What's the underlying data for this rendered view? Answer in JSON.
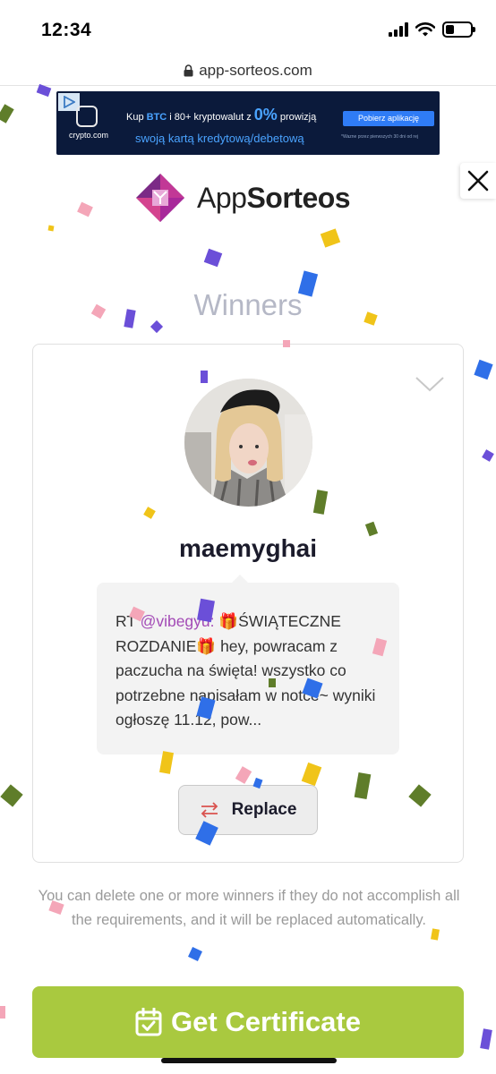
{
  "status_bar": {
    "time": "12:34",
    "battery_level": 0.35
  },
  "browser": {
    "url": "app-sorteos.com"
  },
  "ad": {
    "brand": "crypto.com",
    "line1_prefix": "Kup ",
    "line1_highlight": "BTC",
    "line1_middle": " i 80+ kryptowalut z ",
    "line1_percent": "0%",
    "line1_suffix": " prowizją",
    "line2": "swoją kartą kredytową/debetową",
    "cta": "Pobierz aplikację",
    "fine_print": "*Wazne przez pierwszych 30 dni od rej"
  },
  "header": {
    "logo_text_light": "App",
    "logo_text_bold": "Sorteos"
  },
  "section_title": "Winners",
  "winner": {
    "username": "maemyghai",
    "tweet_prefix": "RT ",
    "tweet_mention": "@vibegyu:",
    "tweet_body": " 🎁ŚWIĄTECZNE ROZDANIE🎁 hey, powracam z paczucha na święta! wszystko co potrzebne napisałam w notce~ wyniki ogłoszę 11.12, pow...",
    "replace_label": "Replace"
  },
  "info_text": "You can delete one or more winners if they do not accomplish all the requirements, and it will be replaced automatically.",
  "certificate_button": "Get Certificate",
  "colors": {
    "accent_green": "#a9c93f",
    "brand_magenta": "#a8289a",
    "mention_purple": "#a34ab6",
    "title_gray": "#b5b8c6"
  }
}
